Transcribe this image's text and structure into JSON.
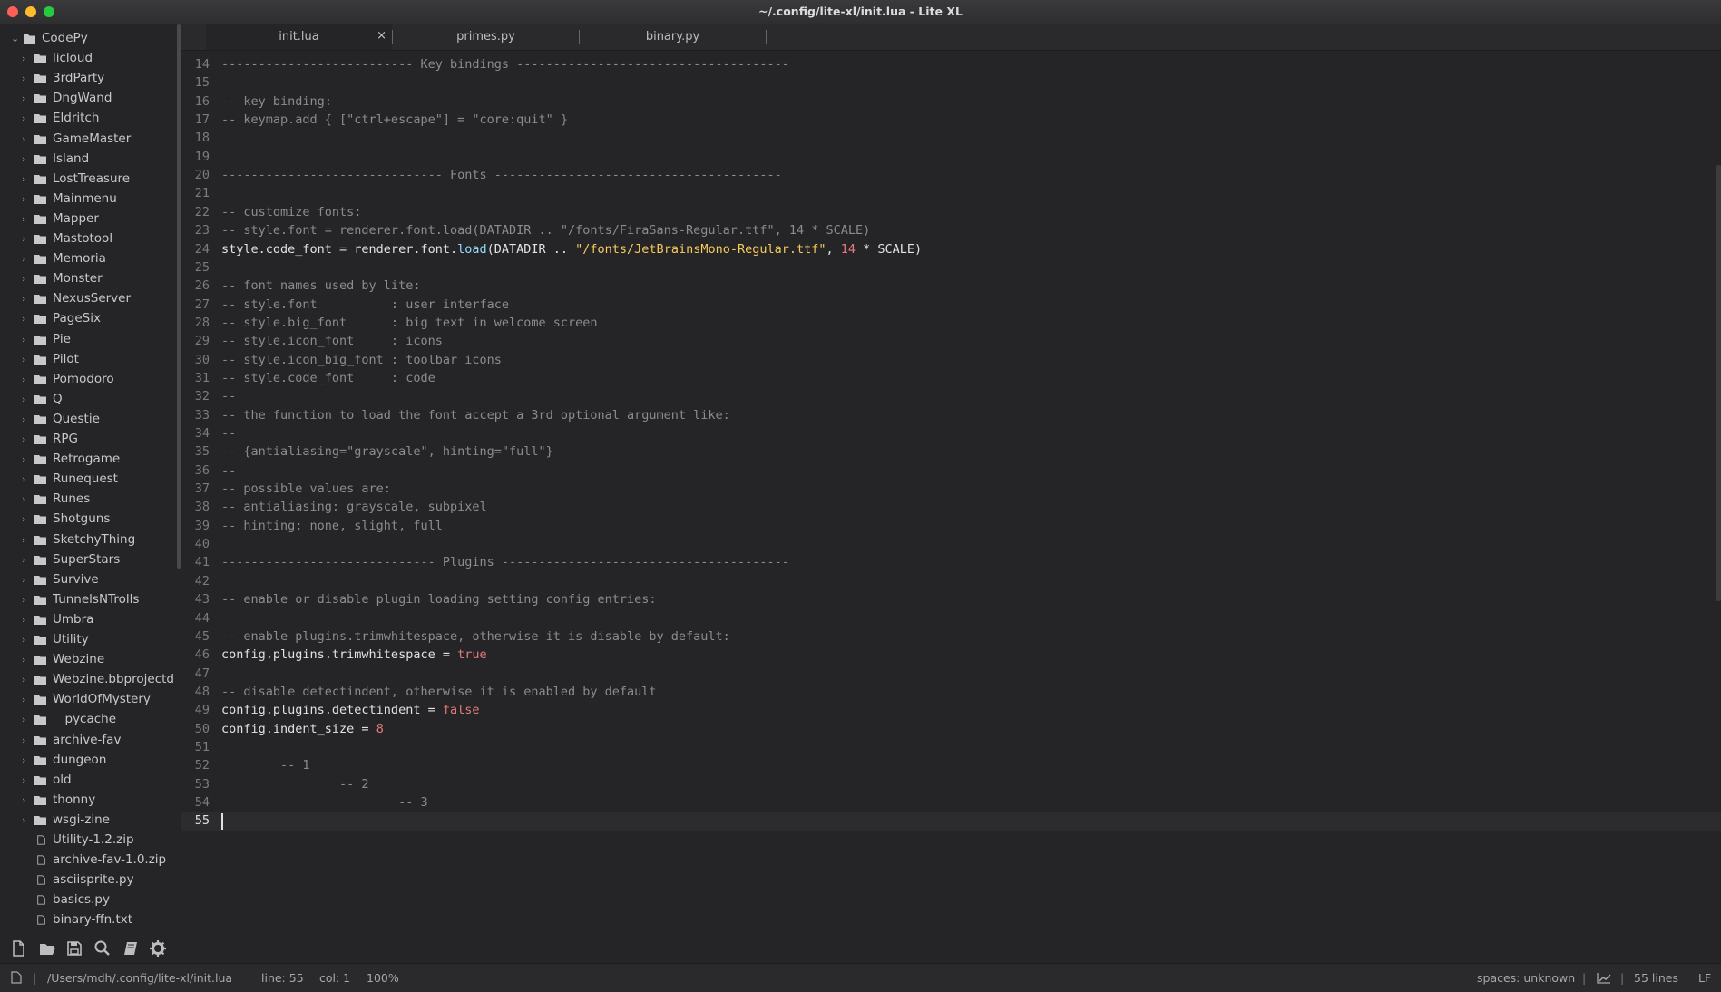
{
  "window": {
    "title": "~/.config/lite-xl/init.lua - Lite XL"
  },
  "tabs": [
    {
      "label": "init.lua",
      "close": "×",
      "active": true
    },
    {
      "label": "primes.py",
      "active": false
    },
    {
      "label": "binary.py",
      "active": false
    }
  ],
  "tree": {
    "root": "CodePy",
    "folders": [
      "licloud",
      "3rdParty",
      "DngWand",
      "Eldritch",
      "GameMaster",
      "Island",
      "LostTreasure",
      "Mainmenu",
      "Mapper",
      "Mastotool",
      "Memoria",
      "Monster",
      "NexusServer",
      "PageSix",
      "Pie",
      "Pilot",
      "Pomodoro",
      "Q",
      "Questie",
      "RPG",
      "Retrogame",
      "Runequest",
      "Runes",
      "Shotguns",
      "SketchyThing",
      "SuperStars",
      "Survive",
      "TunnelsNTrolls",
      "Umbra",
      "Utility",
      "Webzine",
      "Webzine.bbprojectd",
      "WorldOfMystery",
      "__pycache__",
      "archive-fav",
      "dungeon",
      "old",
      "thonny",
      "wsgi-zine"
    ],
    "files": [
      "Utility-1.2.zip",
      "archive-fav-1.0.zip",
      "asciisprite.py",
      "basics.py",
      "binary-ffn.txt"
    ]
  },
  "editor": {
    "first_line": 14,
    "current_line": 55,
    "lines": [
      {
        "n": "14",
        "parts": [
          {
            "t": "-------------------------- Key bindings -------------------------------------",
            "c": "comment"
          }
        ]
      },
      {
        "n": "15",
        "parts": []
      },
      {
        "n": "16",
        "parts": [
          {
            "t": "-- key binding:",
            "c": "comment"
          }
        ]
      },
      {
        "n": "17",
        "parts": [
          {
            "t": "-- keymap.add { [\"ctrl+escape\"] = \"core:quit\" }",
            "c": "comment"
          }
        ]
      },
      {
        "n": "18",
        "parts": []
      },
      {
        "n": "19",
        "parts": []
      },
      {
        "n": "20",
        "parts": [
          {
            "t": "------------------------------ Fonts ---------------------------------------",
            "c": "comment"
          }
        ]
      },
      {
        "n": "21",
        "parts": []
      },
      {
        "n": "22",
        "parts": [
          {
            "t": "-- customize fonts:",
            "c": "comment"
          }
        ]
      },
      {
        "n": "23",
        "parts": [
          {
            "t": "-- style.font = renderer.font.load(DATADIR .. \"/fonts/FiraSans-Regular.ttf\", 14 * SCALE)",
            "c": "comment"
          }
        ]
      },
      {
        "n": "24",
        "parts": [
          {
            "t": "style.code_font = renderer.font.",
            "c": ""
          },
          {
            "t": "load",
            "c": "fn"
          },
          {
            "t": "(DATADIR .. ",
            "c": ""
          },
          {
            "t": "\"/fonts/JetBrainsMono-Regular.ttf\"",
            "c": "str"
          },
          {
            "t": ", ",
            "c": ""
          },
          {
            "t": "14",
            "c": "num"
          },
          {
            "t": " * SCALE)",
            "c": ""
          }
        ]
      },
      {
        "n": "25",
        "parts": []
      },
      {
        "n": "26",
        "parts": [
          {
            "t": "-- font names used by lite:",
            "c": "comment"
          }
        ]
      },
      {
        "n": "27",
        "parts": [
          {
            "t": "-- style.font          : user interface",
            "c": "comment"
          }
        ]
      },
      {
        "n": "28",
        "parts": [
          {
            "t": "-- style.big_font      : big text in welcome screen",
            "c": "comment"
          }
        ]
      },
      {
        "n": "29",
        "parts": [
          {
            "t": "-- style.icon_font     : icons",
            "c": "comment"
          }
        ]
      },
      {
        "n": "30",
        "parts": [
          {
            "t": "-- style.icon_big_font : toolbar icons",
            "c": "comment"
          }
        ]
      },
      {
        "n": "31",
        "parts": [
          {
            "t": "-- style.code_font     : code",
            "c": "comment"
          }
        ]
      },
      {
        "n": "32",
        "parts": [
          {
            "t": "--",
            "c": "comment"
          }
        ]
      },
      {
        "n": "33",
        "parts": [
          {
            "t": "-- the function to load the font accept a 3rd optional argument like:",
            "c": "comment"
          }
        ]
      },
      {
        "n": "34",
        "parts": [
          {
            "t": "--",
            "c": "comment"
          }
        ]
      },
      {
        "n": "35",
        "parts": [
          {
            "t": "-- {antialiasing=\"grayscale\", hinting=\"full\"}",
            "c": "comment"
          }
        ]
      },
      {
        "n": "36",
        "parts": [
          {
            "t": "--",
            "c": "comment"
          }
        ]
      },
      {
        "n": "37",
        "parts": [
          {
            "t": "-- possible values are:",
            "c": "comment"
          }
        ]
      },
      {
        "n": "38",
        "parts": [
          {
            "t": "-- antialiasing: grayscale, subpixel",
            "c": "comment"
          }
        ]
      },
      {
        "n": "39",
        "parts": [
          {
            "t": "-- hinting: none, slight, full",
            "c": "comment"
          }
        ]
      },
      {
        "n": "40",
        "parts": []
      },
      {
        "n": "41",
        "parts": [
          {
            "t": "----------------------------- Plugins ---------------------------------------",
            "c": "comment"
          }
        ]
      },
      {
        "n": "42",
        "parts": []
      },
      {
        "n": "43",
        "parts": [
          {
            "t": "-- enable or disable plugin loading setting config entries:",
            "c": "comment"
          }
        ]
      },
      {
        "n": "44",
        "parts": []
      },
      {
        "n": "45",
        "parts": [
          {
            "t": "-- enable plugins.trimwhitespace, otherwise it is disable by default:",
            "c": "comment"
          }
        ]
      },
      {
        "n": "46",
        "parts": [
          {
            "t": "config.plugins.trimwhitespace = ",
            "c": ""
          },
          {
            "t": "true",
            "c": "kw"
          }
        ]
      },
      {
        "n": "47",
        "parts": []
      },
      {
        "n": "48",
        "parts": [
          {
            "t": "-- disable detectindent, otherwise it is enabled by default",
            "c": "comment"
          }
        ]
      },
      {
        "n": "49",
        "parts": [
          {
            "t": "config.plugins.detectindent = ",
            "c": ""
          },
          {
            "t": "false",
            "c": "kw"
          }
        ]
      },
      {
        "n": "50",
        "parts": [
          {
            "t": "config.indent_size = ",
            "c": ""
          },
          {
            "t": "8",
            "c": "num"
          }
        ]
      },
      {
        "n": "51",
        "parts": []
      },
      {
        "n": "52",
        "parts": [
          {
            "t": "        -- 1",
            "c": "comment"
          }
        ]
      },
      {
        "n": "53",
        "parts": [
          {
            "t": "                -- 2",
            "c": "comment"
          }
        ]
      },
      {
        "n": "54",
        "parts": [
          {
            "t": "                        -- 3",
            "c": "comment"
          }
        ]
      },
      {
        "n": "55",
        "parts": []
      }
    ]
  },
  "toolbar": [
    "new-file-icon",
    "open-folder-icon",
    "save-icon",
    "search-icon",
    "book-icon",
    "gear-icon"
  ],
  "status": {
    "path": "/Users/mdh/.config/lite-xl/init.lua",
    "line": "line: 55",
    "col": "col: 1",
    "zoom": "100%",
    "spaces": "spaces: unknown",
    "lines_count": "55 lines",
    "eol": "LF"
  },
  "colors": {
    "bg": "#252527",
    "comment": "#8c8c8c",
    "string": "#f7c95c",
    "number": "#e47b7b",
    "function": "#93ddfa",
    "text": "#e1e1e6"
  }
}
